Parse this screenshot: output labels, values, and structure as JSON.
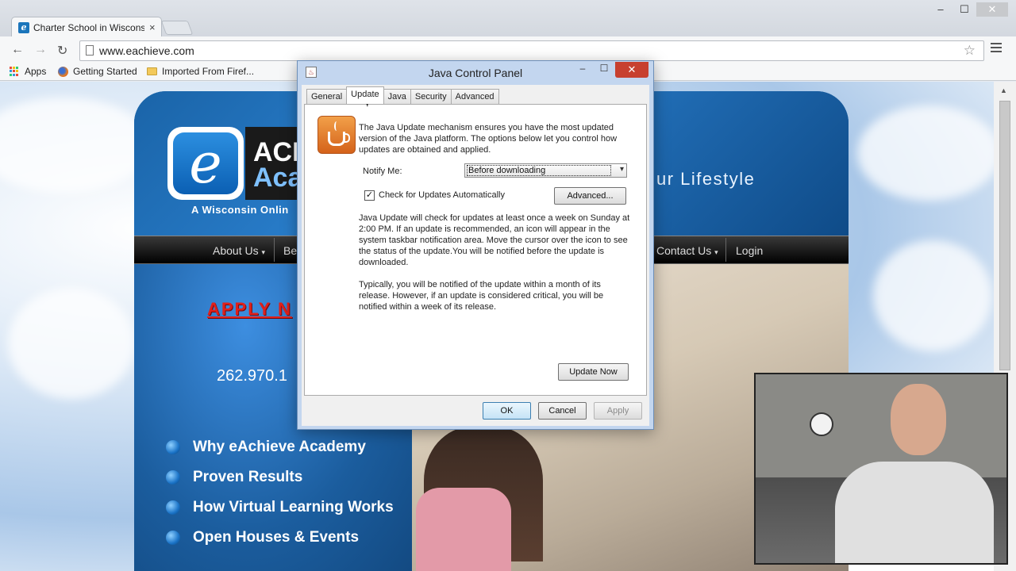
{
  "browser": {
    "tab_title": "Charter School in Wiscons",
    "tab_favicon": "e",
    "tab_close": "×",
    "url": "www.eachieve.com",
    "window_controls": {
      "minimize": "–",
      "maximize": "☐",
      "close": "✕"
    },
    "nav": {
      "back": "←",
      "forward": "→",
      "reload": "↻"
    },
    "bookmarks": [
      {
        "label": "Apps",
        "icon": "apps-grid-icon"
      },
      {
        "label": "Getting Started",
        "icon": "firefox-icon"
      },
      {
        "label": "Imported From Firef...",
        "icon": "folder-icon"
      }
    ]
  },
  "site": {
    "logo_letter": "e",
    "logo_line1": "ACH",
    "logo_line2": "Aca",
    "tagline": "A Wisconsin Onlin",
    "slogan": "ur Lifestyle",
    "nav": [
      {
        "label": "About Us",
        "caret": "▾"
      },
      {
        "label": "Be",
        "caret": ""
      },
      {
        "label": "Contact Us",
        "caret": "▾"
      },
      {
        "label": "Login",
        "caret": ""
      }
    ],
    "apply": "APPLY  N",
    "phone": "262.970.1",
    "menu": [
      "Why eAchieve Academy",
      "Proven Results",
      "How Virtual Learning Works",
      "Open Houses & Events"
    ]
  },
  "dialog": {
    "title": "Java Control Panel",
    "controls": {
      "minimize": "–",
      "maximize": "☐",
      "close": "✕"
    },
    "tabs": [
      "General",
      "Update",
      "Java",
      "Security",
      "Advanced"
    ],
    "active_tab": "Update",
    "intro": "The Java Update mechanism ensures you have the most updated version of the Java platform. The options below let you control how updates are obtained and applied.",
    "notify_label": "Notify Me:",
    "notify_value": "Before downloading",
    "check_label": "Check for Updates Automatically",
    "check_mark": "✓",
    "check_checked": true,
    "advanced_button": "Advanced...",
    "desc1": "Java Update will check for updates at least once a week on Sunday at 2:00 PM. If an update is recommended, an icon will appear in the system taskbar notification area. Move the cursor over the icon to see the status of the update.You will be notified before the update is downloaded.",
    "desc2": "Typically, you will be notified of the update within a month of its release. However, if an update is considered critical, you will be notified within a week of its release.",
    "update_now_button": "Update Now",
    "ok_button": "OK",
    "cancel_button": "Cancel",
    "apply_button": "Apply"
  }
}
